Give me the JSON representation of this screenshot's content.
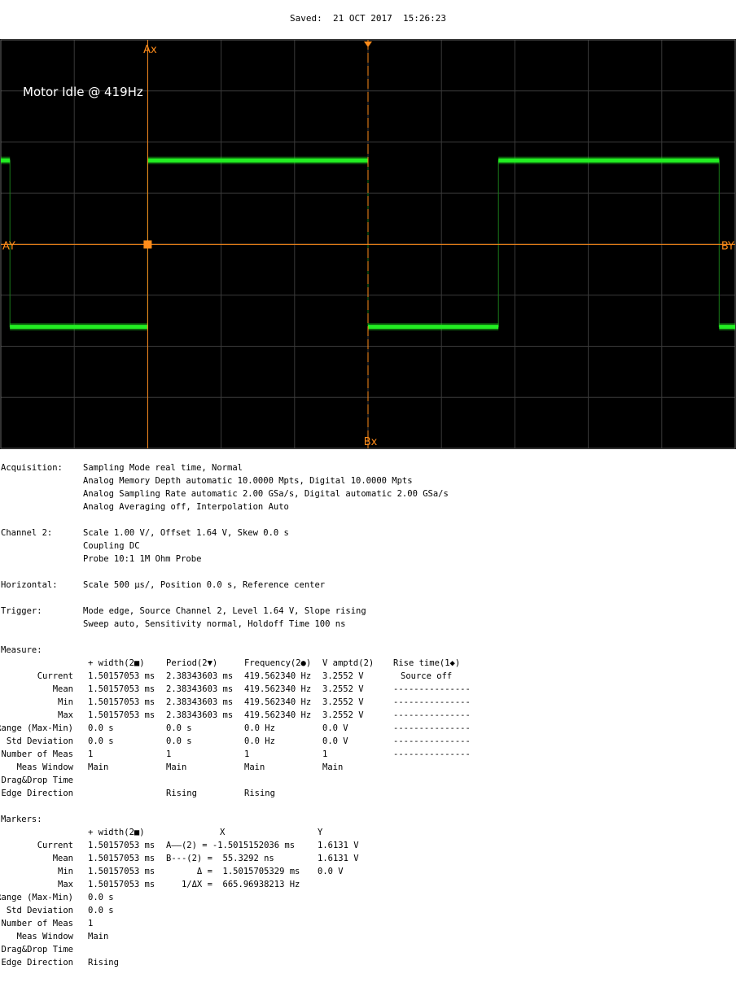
{
  "saved_text": "Saved:  21 OCT 2017  15:26:23",
  "scope": {
    "label": "Motor Idle @ 419Hz",
    "cursor_labels": {
      "ax": "Ax",
      "bx": "Bx",
      "ay": "AY",
      "by": "BY"
    },
    "colors": {
      "background": "#000000",
      "grid": "#3a3a3a",
      "trace": "#22ee22",
      "cursor": "#ff8c1a",
      "label": "#ffffff"
    }
  },
  "chart_data": {
    "type": "line",
    "title": "Motor Idle @ 419Hz",
    "xlabel": "",
    "ylabel": "",
    "x_scale_per_div": "500 µs",
    "y_scale_per_div": "1.00 V",
    "grid": true,
    "series": [
      {
        "x_us": [
          -2500,
          -2438,
          -2438,
          -1500,
          -1500,
          0,
          0,
          888,
          888,
          2391,
          2391,
          2500
        ],
        "y_v": [
          3.26,
          3.26,
          0.0,
          0.0,
          3.26,
          3.26,
          0.0,
          0.0,
          3.26,
          3.26,
          0.0,
          0.0
        ]
      }
    ],
    "xlim": [
      -2500,
      2500
    ],
    "ylim": [
      -2.38,
      5.62
    ],
    "cursor_x_us": {
      "Ax": -1500,
      "Bx": 0
    },
    "cursor_y_v": 1.6131
  },
  "sections": [
    {
      "label": "Acquisition:",
      "lines": [
        "Sampling Mode real time, Normal",
        "Analog Memory Depth automatic 10.0000 Mpts, Digital 10.0000 Mpts",
        "Analog Sampling Rate automatic 2.00 GSa/s, Digital automatic 2.00 GSa/s",
        "Analog Averaging off, Interpolation Auto"
      ]
    },
    {
      "label": "Channel 2:",
      "lines": [
        "Scale 1.00 V/, Offset 1.64 V, Skew 0.0 s",
        "Coupling DC",
        "Probe 10:1 1M Ohm Probe"
      ]
    },
    {
      "label": "Horizontal:",
      "lines": [
        "Scale 500 µs/, Position 0.0 s, Reference center"
      ]
    },
    {
      "label": "Trigger:",
      "lines": [
        "Mode edge, Source Channel 2, Level 1.64 V, Slope rising",
        "Sweep auto, Sensitivity normal, Holdoff Time 100 ns"
      ]
    }
  ],
  "measure": {
    "label": "Measure:",
    "headers": [
      "+ width(2■)",
      "Period(2▼)",
      "Frequency(2●)",
      "V amptd(2)",
      "Rise time(1◆)"
    ],
    "rows": [
      {
        "label": "Current",
        "cells": [
          "1.50157053 ms",
          "2.38343603 ms",
          "419.562340 Hz",
          "3.2552 V",
          "Source off"
        ]
      },
      {
        "label": "Mean",
        "cells": [
          "1.50157053 ms",
          "2.38343603 ms",
          "419.562340 Hz",
          "3.2552 V",
          "---------------"
        ]
      },
      {
        "label": "Min",
        "cells": [
          "1.50157053 ms",
          "2.38343603 ms",
          "419.562340 Hz",
          "3.2552 V",
          "---------------"
        ]
      },
      {
        "label": "Max",
        "cells": [
          "1.50157053 ms",
          "2.38343603 ms",
          "419.562340 Hz",
          "3.2552 V",
          "---------------"
        ]
      },
      {
        "label": "Range (Max-Min)",
        "cells": [
          "0.0 s",
          "0.0 s",
          "0.0 Hz",
          "0.0 V",
          "---------------"
        ]
      },
      {
        "label": "Std Deviation",
        "cells": [
          "0.0 s",
          "0.0 s",
          "0.0 Hz",
          "0.0 V",
          "---------------"
        ]
      },
      {
        "label": "Number of Meas",
        "cells": [
          "1",
          "1",
          "1",
          "1",
          "---------------"
        ]
      },
      {
        "label": "Meas Window",
        "cells": [
          "Main",
          "Main",
          "Main",
          "Main",
          ""
        ]
      },
      {
        "label": "Drag&Drop Time",
        "cells": [
          "",
          "",
          "",
          "",
          ""
        ]
      },
      {
        "label": "Edge Direction",
        "cells": [
          "",
          "Rising",
          "Rising",
          "",
          ""
        ]
      }
    ]
  },
  "markers": {
    "label": "Markers:",
    "headers": [
      "+ width(2■)",
      "X",
      "Y"
    ],
    "rows": [
      {
        "label": "Current",
        "width": "1.50157053 ms",
        "x": "A——(2) = -1.5015152036 ms",
        "y": "1.6131 V"
      },
      {
        "label": "Mean",
        "width": "1.50157053 ms",
        "x": "B---(2) =  55.3292 ns",
        "y": "1.6131 V"
      },
      {
        "label": "Min",
        "width": "1.50157053 ms",
        "x": "      Δ =  1.5015705329 ms",
        "y": "0.0 V"
      },
      {
        "label": "Max",
        "width": "1.50157053 ms",
        "x": "   1/ΔX =  665.96938213 Hz",
        "y": ""
      },
      {
        "label": "Range (Max-Min)",
        "width": "0.0 s",
        "x": "",
        "y": ""
      },
      {
        "label": "Std Deviation",
        "width": "0.0 s",
        "x": "",
        "y": ""
      },
      {
        "label": "Number of Meas",
        "width": "1",
        "x": "",
        "y": ""
      },
      {
        "label": "Meas Window",
        "width": "Main",
        "x": "",
        "y": ""
      },
      {
        "label": "Drag&Drop Time",
        "width": "",
        "x": "",
        "y": ""
      },
      {
        "label": "Edge Direction",
        "width": "Rising",
        "x": "",
        "y": ""
      }
    ]
  }
}
